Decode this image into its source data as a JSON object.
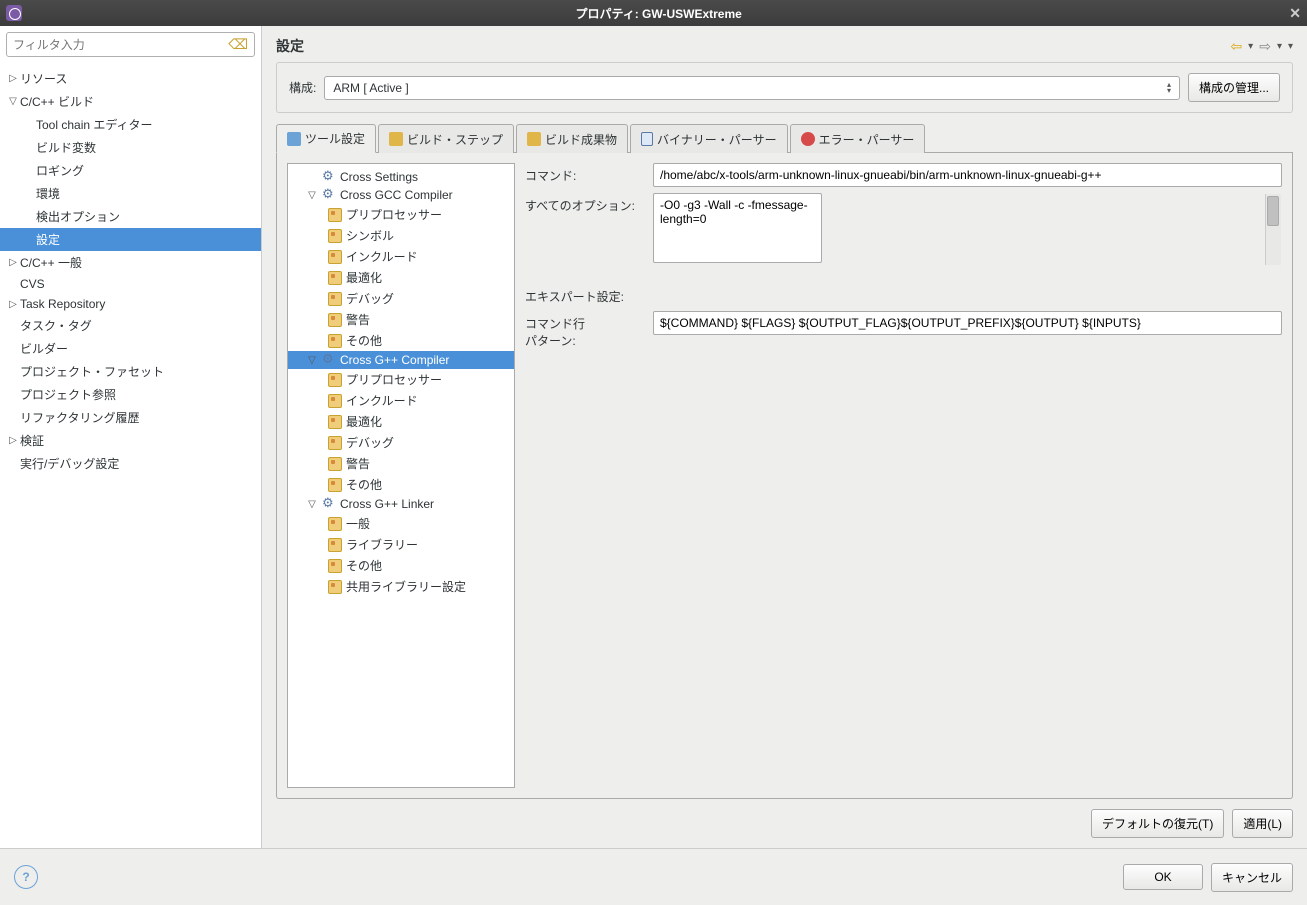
{
  "window": {
    "title": "プロパティ: GW-USWExtreme"
  },
  "filter": {
    "placeholder": "フィルタ入力"
  },
  "sidebar": {
    "items": [
      {
        "label": "リソース",
        "arrow": "▷",
        "indent": 0
      },
      {
        "label": "C/C++ ビルド",
        "arrow": "▽",
        "indent": 0
      },
      {
        "label": "Tool chain エディター",
        "arrow": "",
        "indent": 1
      },
      {
        "label": "ビルド変数",
        "arrow": "",
        "indent": 1
      },
      {
        "label": "ロギング",
        "arrow": "",
        "indent": 1
      },
      {
        "label": "環境",
        "arrow": "",
        "indent": 1
      },
      {
        "label": "検出オプション",
        "arrow": "",
        "indent": 1
      },
      {
        "label": "設定",
        "arrow": "",
        "indent": 1,
        "selected": true
      },
      {
        "label": "C/C++ 一般",
        "arrow": "▷",
        "indent": 0
      },
      {
        "label": "CVS",
        "arrow": "",
        "indent": 0
      },
      {
        "label": "Task Repository",
        "arrow": "▷",
        "indent": 0
      },
      {
        "label": "タスク・タグ",
        "arrow": "",
        "indent": 0
      },
      {
        "label": "ビルダー",
        "arrow": "",
        "indent": 0
      },
      {
        "label": "プロジェクト・ファセット",
        "arrow": "",
        "indent": 0
      },
      {
        "label": "プロジェクト参照",
        "arrow": "",
        "indent": 0
      },
      {
        "label": "リファクタリング履歴",
        "arrow": "",
        "indent": 0
      },
      {
        "label": "検証",
        "arrow": "▷",
        "indent": 0
      },
      {
        "label": "実行/デバッグ設定",
        "arrow": "",
        "indent": 0
      }
    ]
  },
  "header": {
    "title": "設定"
  },
  "config": {
    "label": "構成:",
    "value": "ARM  [ Active ]",
    "manage_btn": "構成の管理..."
  },
  "tabs": [
    {
      "label": "ツール設定",
      "active": true,
      "icon": "blue"
    },
    {
      "label": "ビルド・ステップ",
      "icon": "yellow"
    },
    {
      "label": "ビルド成果物",
      "icon": "green"
    },
    {
      "label": "バイナリー・パーサー",
      "icon": "blue2"
    },
    {
      "label": "エラー・パーサー",
      "icon": "red"
    }
  ],
  "tooltree": [
    {
      "label": "Cross Settings",
      "level": 1,
      "icon": "gear"
    },
    {
      "label": "Cross GCC Compiler",
      "level": 1,
      "icon": "gear",
      "arrow": "▽"
    },
    {
      "label": "プリプロセッサー",
      "level": 2,
      "icon": "file"
    },
    {
      "label": "シンボル",
      "level": 2,
      "icon": "file"
    },
    {
      "label": "インクルード",
      "level": 2,
      "icon": "file"
    },
    {
      "label": "最適化",
      "level": 2,
      "icon": "file"
    },
    {
      "label": "デバッグ",
      "level": 2,
      "icon": "file"
    },
    {
      "label": "警告",
      "level": 2,
      "icon": "file"
    },
    {
      "label": "その他",
      "level": 2,
      "icon": "file"
    },
    {
      "label": "Cross G++ Compiler",
      "level": 1,
      "icon": "gear",
      "arrow": "▽",
      "selected": true
    },
    {
      "label": "プリプロセッサー",
      "level": 2,
      "icon": "file"
    },
    {
      "label": "インクルード",
      "level": 2,
      "icon": "file"
    },
    {
      "label": "最適化",
      "level": 2,
      "icon": "file"
    },
    {
      "label": "デバッグ",
      "level": 2,
      "icon": "file"
    },
    {
      "label": "警告",
      "level": 2,
      "icon": "file"
    },
    {
      "label": "その他",
      "level": 2,
      "icon": "file"
    },
    {
      "label": "Cross G++ Linker",
      "level": 1,
      "icon": "gear",
      "arrow": "▽"
    },
    {
      "label": "一般",
      "level": 2,
      "icon": "file"
    },
    {
      "label": "ライブラリー",
      "level": 2,
      "icon": "file"
    },
    {
      "label": "その他",
      "level": 2,
      "icon": "file"
    },
    {
      "label": "共用ライブラリー設定",
      "level": 2,
      "icon": "file"
    }
  ],
  "form": {
    "command_label": "コマンド:",
    "command_value": "/home/abc/x-tools/arm-unknown-linux-gnueabi/bin/arm-unknown-linux-gnueabi-g++",
    "all_options_label": "すべてのオプション:",
    "all_options_value": "-O0 -g3 -Wall -c -fmessage-length=0",
    "expert_label": "エキスパート設定:",
    "pattern_label": "コマンド行\nパターン:",
    "pattern_value": "${COMMAND} ${FLAGS} ${OUTPUT_FLAG}${OUTPUT_PREFIX}${OUTPUT} ${INPUTS}"
  },
  "buttons": {
    "restore": "デフォルトの復元(T)",
    "apply": "適用(L)",
    "ok": "OK",
    "cancel": "キャンセル"
  }
}
